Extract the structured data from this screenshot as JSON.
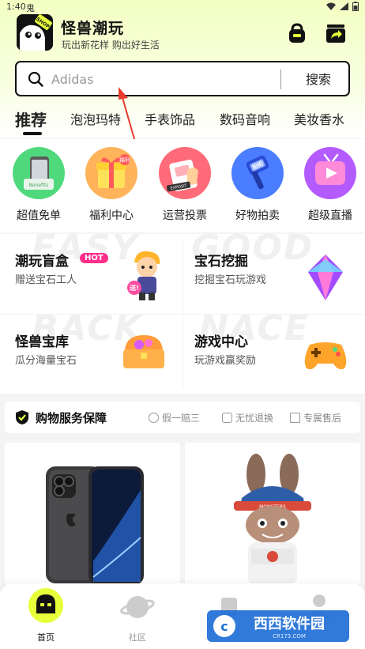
{
  "status_bar": {
    "time": "1:40",
    "app_glyph": "鬼"
  },
  "header": {
    "title": "怪兽潮玩",
    "slogan": "玩出新花样 购出好生活",
    "logo_text": "SHOP"
  },
  "search": {
    "placeholder": "Adidas",
    "button_label": "搜索"
  },
  "tabs": [
    "推荐",
    "泡泡玛特",
    "手表饰品",
    "数码音响",
    "美妆香水"
  ],
  "features": [
    {
      "label": "超值免单",
      "icon": "phone-gift-icon",
      "color": "#4fd97c"
    },
    {
      "label": "福利中心",
      "icon": "gift-box-icon",
      "color": "#ffb35a"
    },
    {
      "label": "运营投票",
      "icon": "vote-card-icon",
      "color": "#ff6b78"
    },
    {
      "label": "好物拍卖",
      "icon": "auction-hammer-icon",
      "color": "#4a7dff"
    },
    {
      "label": "超级直播",
      "icon": "tv-play-icon",
      "color": "#b45bff"
    }
  ],
  "promos": [
    {
      "title": "潮玩盲盒",
      "sub": "赠送宝石工人",
      "badge": "HOT",
      "ghost": "EASY",
      "sticker": "送!"
    },
    {
      "title": "宝石挖掘",
      "sub": "挖掘宝石玩游戏",
      "ghost": "GOOD"
    },
    {
      "title": "怪兽宝库",
      "sub": "瓜分海量宝石",
      "ghost": "BACK"
    },
    {
      "title": "游戏中心",
      "sub": "玩游戏赢奖励",
      "ghost": "NACE"
    }
  ],
  "guarantee": {
    "title": "购物服务保障",
    "items": [
      "假一赔三",
      "无忧退换",
      "专属售后"
    ]
  },
  "products": [
    {
      "name": "iPhone",
      "icon": "smartphone-icon"
    },
    {
      "name": "Labubu",
      "icon": "plush-toy-icon",
      "cap_text": "MONSTERS"
    }
  ],
  "feature_badges": {
    "feature_0": "Benefits",
    "feature_2": "EXPOSIT",
    "feature_3": "拍拍",
    "feature_1": "福利"
  },
  "bottom_nav": [
    {
      "label": "首页",
      "active": true
    },
    {
      "label": "社区",
      "active": false
    },
    {
      "label": "",
      "active": false
    },
    {
      "label": "",
      "active": false
    }
  ],
  "watermark": {
    "text": "西西软件园",
    "sub": "CR173.COM"
  },
  "colors": {
    "accent": "#e6ff3a",
    "hot": "#ff2e8b",
    "arrow": "#e83a2f"
  }
}
